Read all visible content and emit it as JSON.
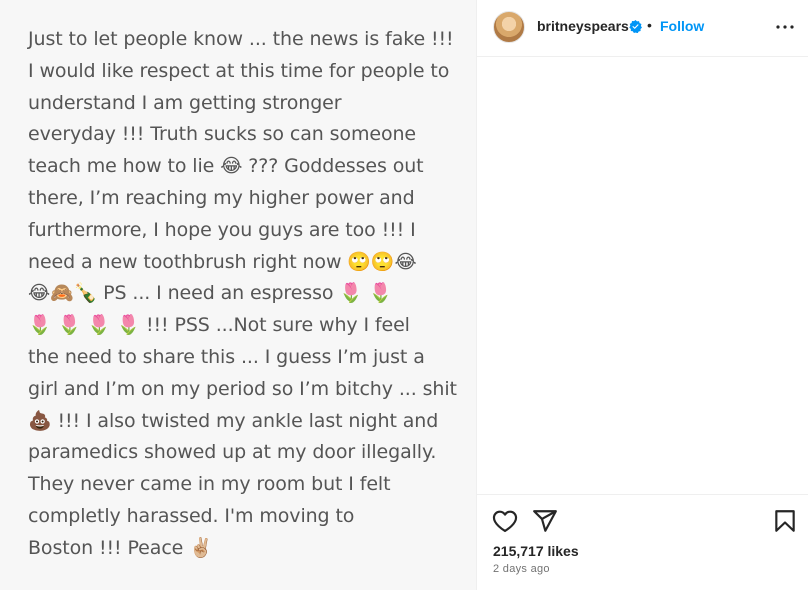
{
  "post": {
    "text_lines": [
      "Just to let people know ... the news is fake !!!",
      "I would like respect at this time for people to",
      "understand I am getting stronger",
      "everyday !!! Truth sucks so can someone",
      "teach me how to lie 😂 ??? Goddesses out",
      "there, I’m reaching my higher power and",
      "furthermore, I hope you guys are too !!! I",
      "need a new toothbrush right now 🙄🙄😂",
      "😂🙈🍾 PS ... I need an espresso 🌷 🌷",
      "🌷 🌷 🌷 🌷 !!! PSS ...Not sure why I feel",
      "the need to share this ... I guess I’m just a",
      "girl and I’m on my period so I’m bitchy ... shit",
      "💩 !!! I also twisted my ankle last night and",
      "paramedics showed up at my door illegally.",
      "They never came in my room but I felt",
      "completly harassed.  I'm moving to",
      "Boston !!! Peace ✌🏼"
    ]
  },
  "header": {
    "username": "britneyspears",
    "separator": "•",
    "follow_label": "Follow"
  },
  "footer": {
    "likes": "215,717 likes",
    "timestamp": "2 days ago"
  },
  "icons": {
    "like": "heart-icon",
    "share": "paper-plane-icon",
    "save": "bookmark-icon",
    "more": "more-options-icon",
    "verified": "verified-badge-icon"
  },
  "colors": {
    "link": "#0095f6",
    "verified": "#0095f6",
    "post_text": "#555555",
    "border": "#efefef"
  }
}
